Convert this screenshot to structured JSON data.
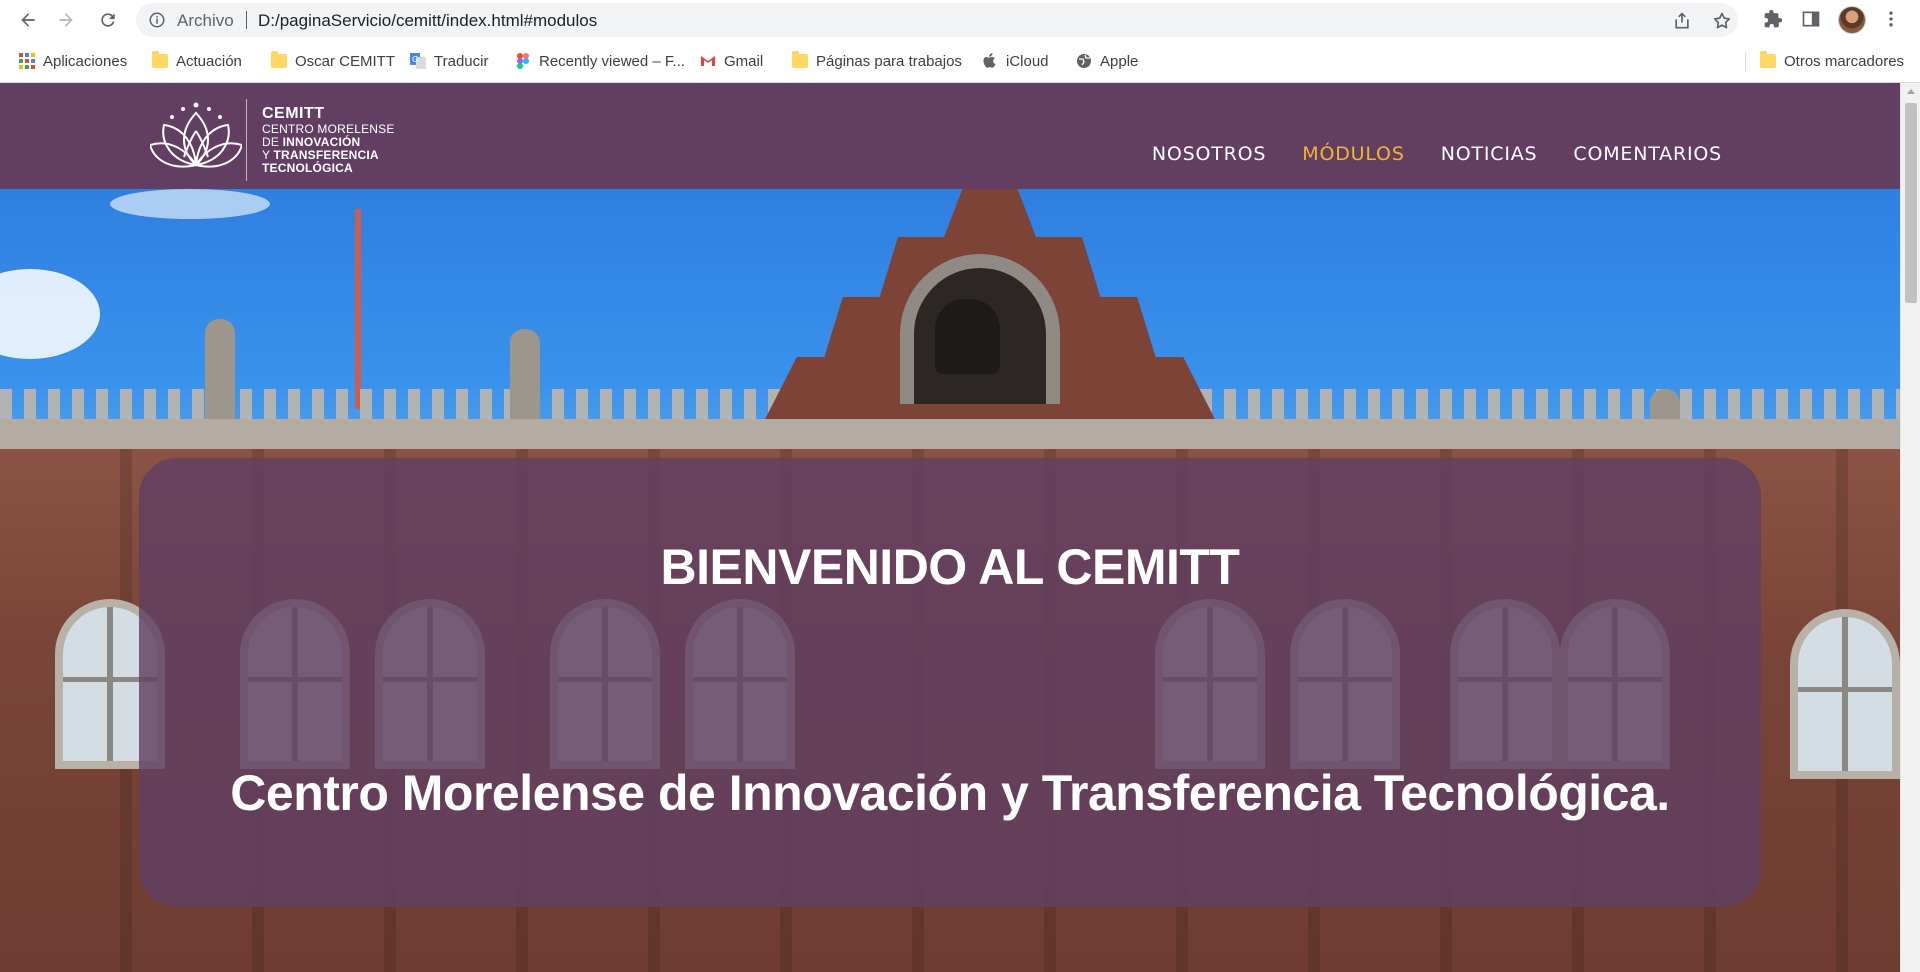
{
  "browser": {
    "scheme_label": "Archivo",
    "url": "D:/paginaServicio/cemitt/index.html#modulos"
  },
  "bookmarks": [
    {
      "label": "Aplicaciones",
      "icon": "apps-grid-icon"
    },
    {
      "label": "Actuación",
      "icon": "folder-icon"
    },
    {
      "label": "Oscar CEMITT",
      "icon": "folder-icon"
    },
    {
      "label": "Traducir",
      "icon": "translate-icon"
    },
    {
      "label": "Recently viewed – F...",
      "icon": "figma-icon"
    },
    {
      "label": "Gmail",
      "icon": "gmail-icon"
    },
    {
      "label": "Páginas para trabajos",
      "icon": "folder-icon"
    },
    {
      "label": "iCloud",
      "icon": "apple-icon"
    },
    {
      "label": "Apple",
      "icon": "globe-icon"
    }
  ],
  "other_bookmarks": "Otros marcadores",
  "site": {
    "logo": {
      "name": "CEMITT",
      "line1": "CENTRO MORELENSE",
      "line2_pre": "DE ",
      "line2_bold": "INNOVACIÓN",
      "line3_pre": "Y ",
      "line3_bold": "TRANSFERENCIA",
      "line4": "TECNOLÓGICA"
    },
    "nav": [
      {
        "label": "NOSOTROS",
        "active": false
      },
      {
        "label": "MÓDULOS",
        "active": true
      },
      {
        "label": "NOTICIAS",
        "active": false
      },
      {
        "label": "COMENTARIOS",
        "active": false
      }
    ],
    "colors": {
      "header": "#623f62",
      "nav_active": "#f2b52e",
      "card": "rgba(98,63,98,0.82)"
    }
  },
  "hero": {
    "title": "BIENVENIDO AL CEMITT",
    "subtitle": "Centro Morelense de Innovación y Transferencia Tecnológica."
  }
}
